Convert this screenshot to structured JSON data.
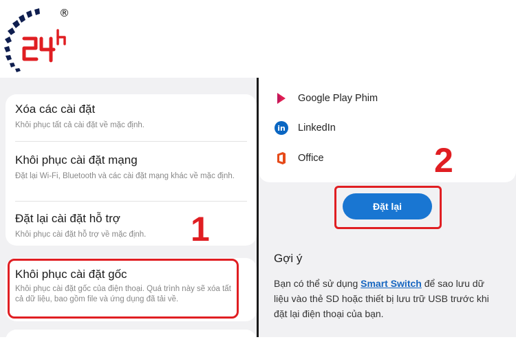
{
  "logo": {
    "text": "24h",
    "registered_mark": "®",
    "brand_color": "#0f1e4f",
    "accent_color": "#e01e22"
  },
  "step_numbers": {
    "first": "1",
    "second": "2"
  },
  "left_panel": {
    "items": [
      {
        "title": "Xóa các cài đặt",
        "subtitle": "Khôi phục tất cả cài đặt về mặc định."
      },
      {
        "title": "Khôi phục cài đặt mạng",
        "subtitle": "Đặt lại Wi-Fi, Bluetooth và các cài đặt mạng khác về mặc định."
      },
      {
        "title": "Đặt lại cài đặt hỗ trợ",
        "subtitle": "Khôi phục cài đặt hỗ trợ về mặc định."
      },
      {
        "title": "Khôi phục cài đặt gốc",
        "subtitle": "Khôi phục cài đặt gốc của điện thoại. Quá trình này sẽ xóa tất cả dữ liệu, bao gồm file và ứng dụng đã tải về."
      }
    ]
  },
  "right_panel": {
    "apps": [
      {
        "name": "Google Play Phim",
        "icon": "google-play-movies-icon"
      },
      {
        "name": "LinkedIn",
        "icon": "linkedin-icon",
        "icon_text": "in"
      },
      {
        "name": "Office",
        "icon": "office-icon"
      }
    ],
    "reset_button_label": "Đặt lại",
    "hint": {
      "title": "Gợi ý",
      "text_before": "Bạn có thể sử dụng ",
      "link": "Smart Switch",
      "text_after": " để sao lưu dữ liệu vào thẻ SD hoặc thiết bị lưu trữ USB trước khi đặt lại điện thoại của bạn."
    }
  }
}
